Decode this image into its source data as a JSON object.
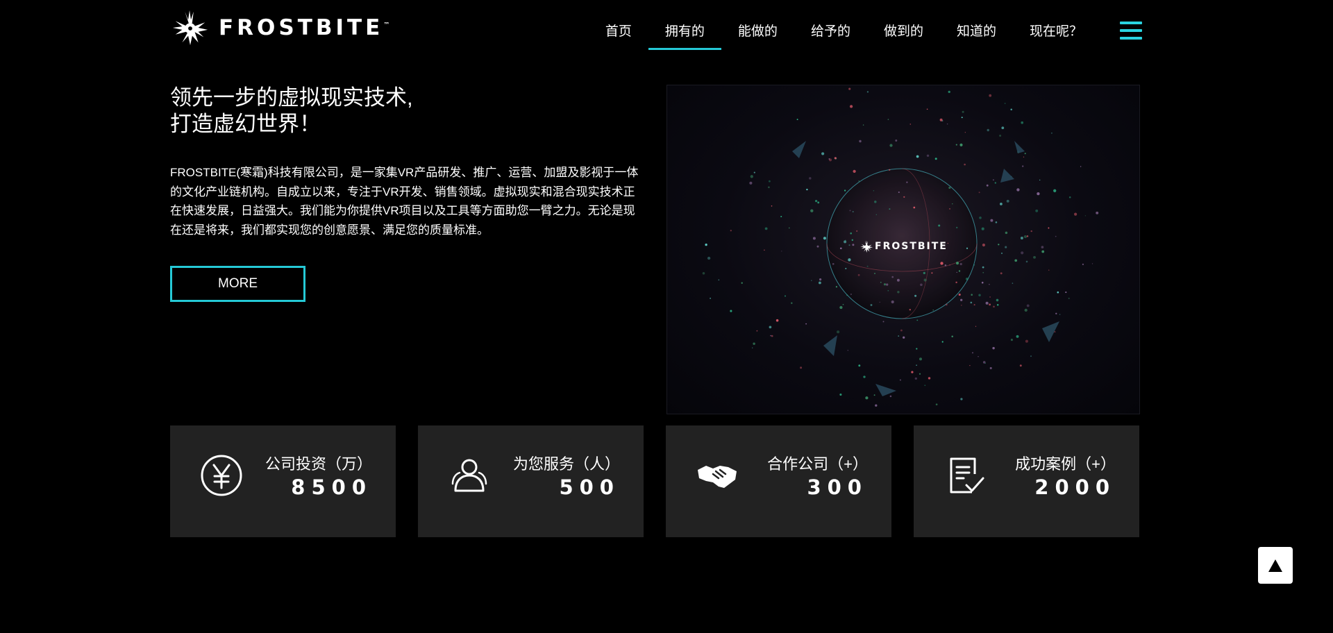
{
  "brand": {
    "name": "FROSTBITE",
    "tm": "™"
  },
  "nav": {
    "items": [
      {
        "label": "首页"
      },
      {
        "label": "拥有的"
      },
      {
        "label": "能做的"
      },
      {
        "label": "给予的"
      },
      {
        "label": "做到的"
      },
      {
        "label": "知道的"
      },
      {
        "label": "现在呢？"
      }
    ],
    "active_index": 1
  },
  "hero": {
    "title_line1": "领先一步的虚拟现实技术,",
    "title_line2": "打造虚幻世界！",
    "description": "FROSTBITE(寒霜)科技有限公司，是一家集VR产品研发、推广、运营、加盟及影视于一体的文化产业链机构。自成立以来，专注于VR开发、销售领域。虚拟现实和混合现实技术正在快速发展，日益强大。我们能为你提供VR项目以及工具等方面助您一臂之力。无论是现在还是将来，我们都实现您的创意愿景、满足您的质量标准。",
    "more_label": "MORE",
    "visual_logo_text": "FROSTBITE"
  },
  "stats": [
    {
      "icon": "yen-icon",
      "label": "公司投资（万）",
      "value": "8500"
    },
    {
      "icon": "users-icon",
      "label": "为您服务（人）",
      "value": "500"
    },
    {
      "icon": "handshake-icon",
      "label": "合作公司（+）",
      "value": "300"
    },
    {
      "icon": "document-check-icon",
      "label": "成功案例（+）",
      "value": "2000"
    }
  ],
  "colors": {
    "accent": "#25c9d6",
    "card_bg": "#222222",
    "page_bg": "#000000"
  }
}
